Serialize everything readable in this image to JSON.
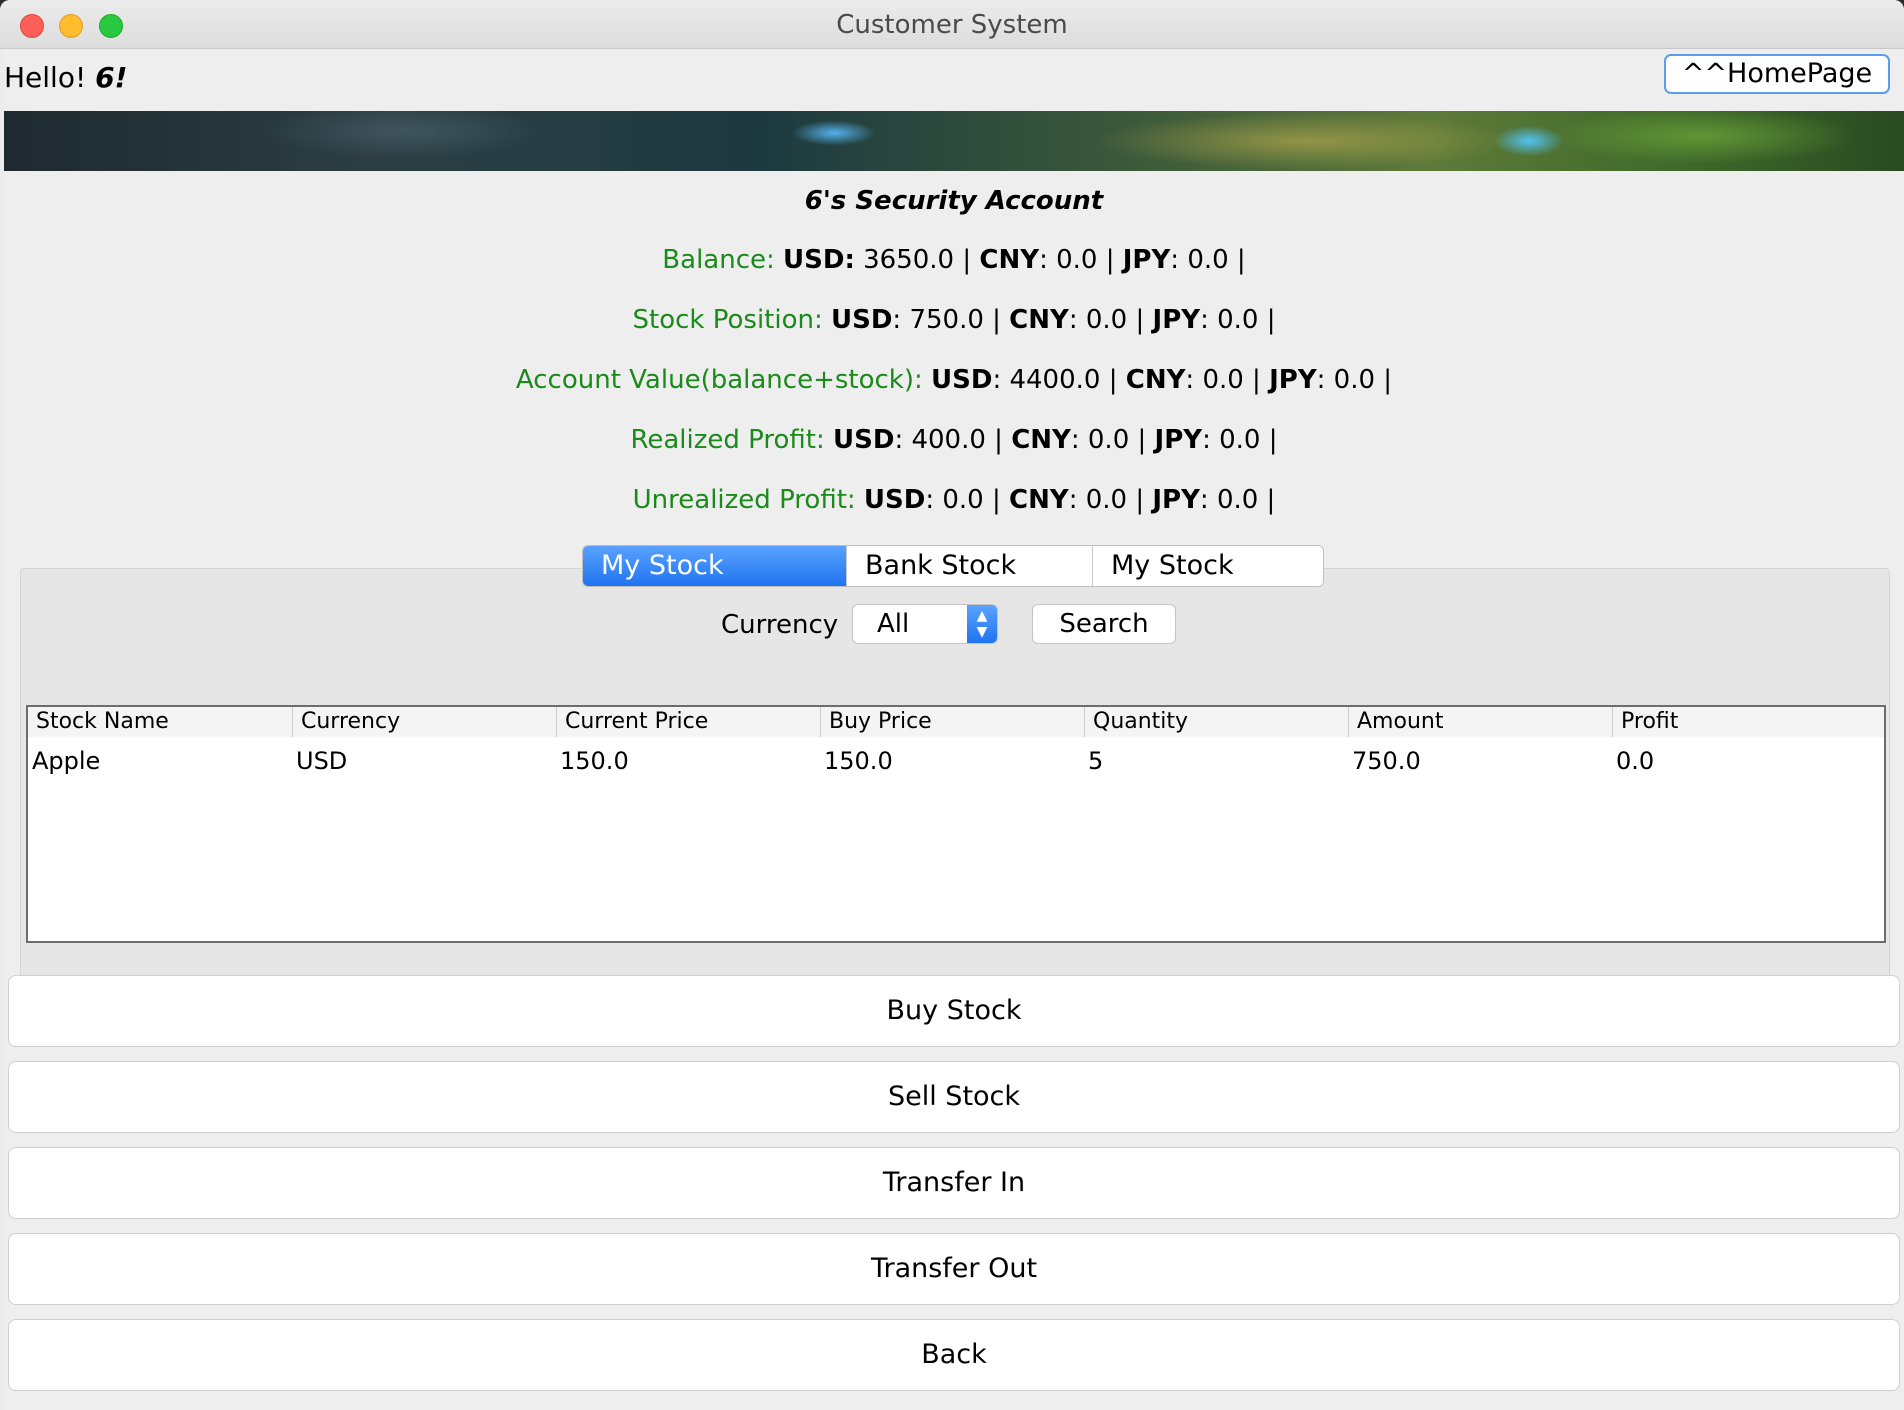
{
  "window": {
    "title": "Customer System"
  },
  "header": {
    "greeting": "Hello!",
    "username": "6!",
    "home_button": "^^HomePage"
  },
  "account": {
    "title": "6's Security Account",
    "lines": [
      {
        "label": "Balance:",
        "usd_key": "USD:",
        "usd": " 3650.0 | ",
        "cny_key": "CNY",
        "cny": ": 0.0 | ",
        "jpy_key": "JPY",
        "jpy": ": 0.0 |"
      },
      {
        "label": "Stock Position:",
        "usd_key": "USD",
        "usd": ": 750.0 | ",
        "cny_key": "CNY",
        "cny": ": 0.0 | ",
        "jpy_key": "JPY",
        "jpy": ": 0.0 |"
      },
      {
        "label": "Account Value(balance+stock):",
        "usd_key": "USD",
        "usd": ": 4400.0 | ",
        "cny_key": "CNY",
        "cny": ": 0.0 | ",
        "jpy_key": "JPY",
        "jpy": ": 0.0 |"
      },
      {
        "label": "Realized Profit:",
        "usd_key": "USD",
        "usd": ": 400.0 | ",
        "cny_key": "CNY",
        "cny": ": 0.0 | ",
        "jpy_key": "JPY",
        "jpy": ": 0.0 |"
      },
      {
        "label": "Unrealized Profit:",
        "usd_key": "USD",
        "usd": ": 0.0 | ",
        "cny_key": "CNY",
        "cny": ": 0.0 | ",
        "jpy_key": "JPY",
        "jpy": ": 0.0 |"
      }
    ]
  },
  "tabs": [
    "My Stock Position",
    "Bank Stock Pool",
    "My Stock Profit"
  ],
  "filter": {
    "label": "Currency",
    "selected": "All",
    "search_button": "Search"
  },
  "table": {
    "columns": [
      "Stock Name",
      "Currency",
      "Current Price",
      "Buy Price",
      "Quantity",
      "Amount",
      "Profit"
    ],
    "rows": [
      [
        "Apple",
        "USD",
        "150.0",
        "150.0",
        "5",
        "750.0",
        "0.0"
      ]
    ]
  },
  "actions": [
    "Buy Stock",
    "Sell Stock",
    "Transfer In",
    "Transfer Out",
    "Back"
  ],
  "colors": {
    "label_green": "#1a8a1a",
    "accent_blue": "#1f74f0"
  }
}
